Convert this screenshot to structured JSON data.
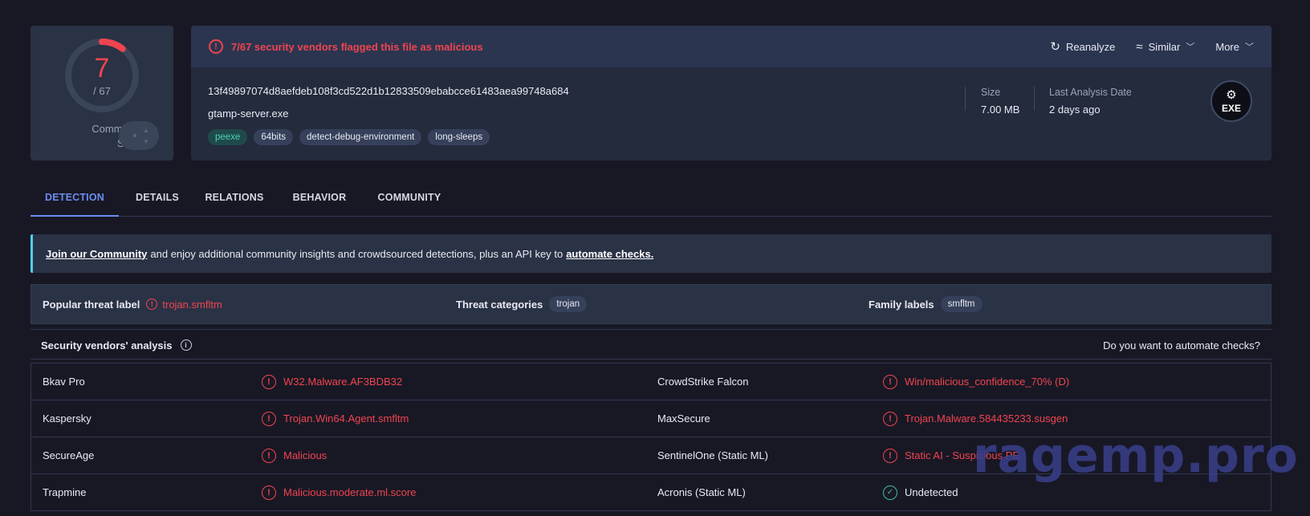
{
  "score": {
    "detections": "7",
    "total": "/ 67",
    "community_label_line1": "Community",
    "community_label_line2": "Score",
    "detection_fraction": 0.1045,
    "ring_color": "#f0444f"
  },
  "header": {
    "flag_text": "7/67 security vendors flagged this file as malicious",
    "actions": {
      "reanalyze": "Reanalyze",
      "similar": "Similar",
      "more": "More"
    },
    "hash": "13f49897074d8aefdeb108f3cd522d1b12833509ebabcce61483aea99748a684",
    "filename": "gtamp-server.exe",
    "tags": [
      "peexe",
      "64bits",
      "detect-debug-environment",
      "long-sleeps"
    ],
    "size_label": "Size",
    "size_value": "7.00 MB",
    "date_label": "Last Analysis Date",
    "date_value": "2 days ago",
    "badge_text": "EXE"
  },
  "tabs": [
    "DETECTION",
    "DETAILS",
    "RELATIONS",
    "BEHAVIOR",
    "COMMUNITY"
  ],
  "banner": {
    "link1": "Join our Community",
    "middle": "and enjoy additional community insights and crowdsourced detections, plus an API key to",
    "link2": "automate checks."
  },
  "threat": {
    "popular_label": "Popular threat label",
    "popular_value": "trojan.smfltm",
    "categories_label": "Threat categories",
    "categories_value": "trojan",
    "family_label": "Family labels",
    "family_value": "smfltm"
  },
  "vendors": {
    "title": "Security vendors' analysis",
    "automate": "Do you want to automate checks?",
    "rows": [
      {
        "left_vendor": "Bkav Pro",
        "left_result": "W32.Malware.AF3BDB32",
        "right_vendor": "CrowdStrike Falcon",
        "right_result": "Win/malicious_confidence_70% (D)"
      },
      {
        "left_vendor": "Kaspersky",
        "left_result": "Trojan.Win64.Agent.smfltm",
        "right_vendor": "MaxSecure",
        "right_result": "Trojan.Malware.584435233.susgen"
      },
      {
        "left_vendor": "SecureAge",
        "left_result": "Malicious",
        "right_vendor": "SentinelOne (Static ML)",
        "right_result": "Static AI - Suspicious PE"
      },
      {
        "left_vendor": "Trapmine",
        "left_result": "Malicious.moderate.ml.score",
        "right_vendor": "Acronis (Static ML)",
        "right_result": "Undetected"
      }
    ]
  },
  "watermark": "ragemp.pro",
  "colors": {
    "malicious": "#f0444f",
    "accent": "#6c8df0",
    "ok": "#3fbf8f"
  }
}
